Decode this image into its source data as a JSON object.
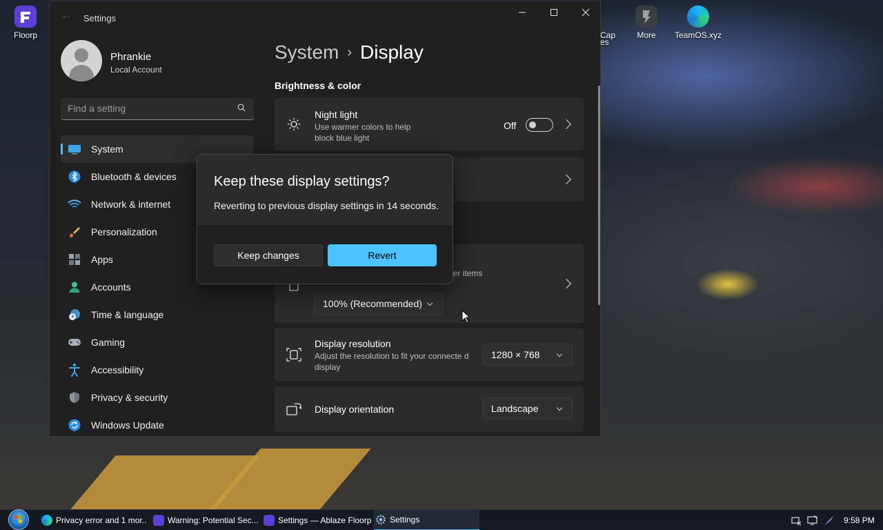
{
  "desktop": {
    "icons": [
      {
        "label": "Floorp",
        "icon": "floorp-icon"
      },
      {
        "label": "Cap",
        "icon": "cap-icon"
      },
      {
        "label": "More",
        "icon": "more-icon"
      },
      {
        "label": "TeamOS.xyz",
        "icon": "edge-icon"
      }
    ],
    "cap_label_fragment": "es"
  },
  "window": {
    "title": "Settings",
    "controls": {
      "minimize": "—",
      "maximize": "☐",
      "close": "✕"
    }
  },
  "profile": {
    "name": "Phrankie",
    "account_type": "Local Account"
  },
  "search": {
    "placeholder": "Find a setting",
    "value": ""
  },
  "sidebar": {
    "items": [
      {
        "label": "System",
        "icon": "system-icon",
        "active": true
      },
      {
        "label": "Bluetooth & devices",
        "icon": "bluetooth-icon"
      },
      {
        "label": "Network & internet",
        "icon": "wifi-icon"
      },
      {
        "label": "Personalization",
        "icon": "brush-icon"
      },
      {
        "label": "Apps",
        "icon": "apps-icon"
      },
      {
        "label": "Accounts",
        "icon": "accounts-icon"
      },
      {
        "label": "Time & language",
        "icon": "clock-globe-icon"
      },
      {
        "label": "Gaming",
        "icon": "gamepad-icon"
      },
      {
        "label": "Accessibility",
        "icon": "accessibility-icon"
      },
      {
        "label": "Privacy & security",
        "icon": "shield-icon"
      },
      {
        "label": "Windows Update",
        "icon": "update-icon"
      }
    ]
  },
  "main": {
    "breadcrumb": {
      "parent": "System",
      "separator": "›",
      "current": "Display"
    },
    "section_title": "Brightness & color",
    "night_light": {
      "title": "Night light",
      "description": "Use warmer colors to help block blue light",
      "state_label": "Off",
      "toggle_on": false
    },
    "scale": {
      "desc_fragment": "her items",
      "value": "100% (Recommended)"
    },
    "resolution": {
      "title": "Display resolution",
      "description": "Adjust the resolution to fit your connecte d display",
      "value": "1280 × 768"
    },
    "orientation": {
      "title": "Display orientation",
      "value": "Landscape"
    }
  },
  "dialog": {
    "title": "Keep these display settings?",
    "message": "Reverting to previous display settings in 14 seconds.",
    "keep_label": "Keep changes",
    "revert_label": "Revert"
  },
  "taskbar": {
    "items": [
      {
        "label": "Privacy error and 1 mor...",
        "icon": "edge-icon"
      },
      {
        "label": "Warning: Potential Sec...",
        "icon": "floorp-icon"
      },
      {
        "label": "Settings — Ablaze Floorp",
        "icon": "floorp-icon"
      },
      {
        "label": "Settings",
        "icon": "gear-icon",
        "active": true
      }
    ],
    "clock": "9:58 PM"
  },
  "colors": {
    "accent": "#4cc2ff",
    "window_bg": "#202020",
    "card_bg": "#2b2b2b"
  }
}
